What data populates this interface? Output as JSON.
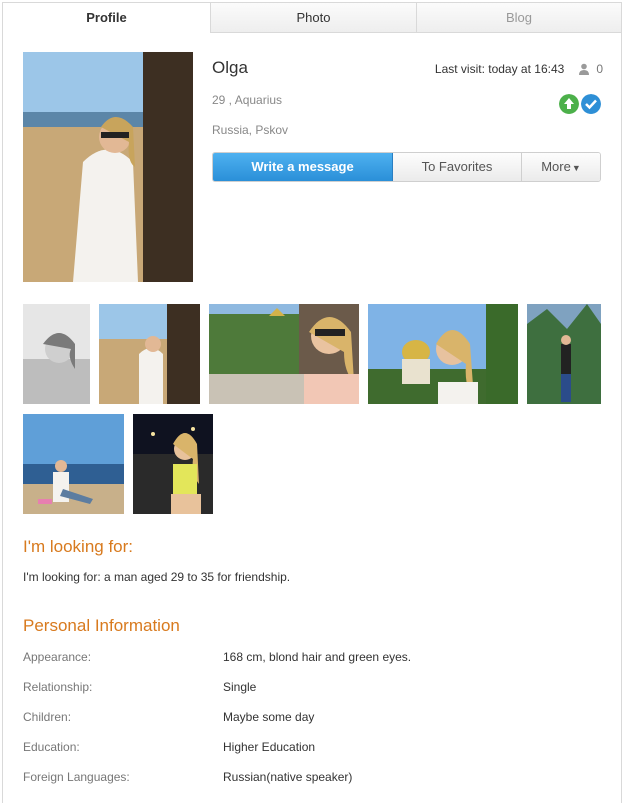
{
  "tabs": [
    {
      "label": "Profile",
      "active": true
    },
    {
      "label": "Photo",
      "active": false
    },
    {
      "label": "Blog",
      "active": false
    }
  ],
  "profile": {
    "name": "Olga",
    "last_visit": "Last visit: today at 16:43",
    "view_count": "0",
    "age_sign": "29 , Aquarius",
    "location": "Russia, Pskov",
    "badges": [
      {
        "icon": "arrow-up-icon",
        "color": "#4cb04a"
      },
      {
        "icon": "check-icon",
        "color": "#2e8fd6"
      }
    ]
  },
  "actions": {
    "message": "Write a message",
    "favorites": "To Favorites",
    "more": "More"
  },
  "looking_for": {
    "title": "I'm looking for:",
    "text": "I'm looking for: a man aged 29 to 35 for friendship."
  },
  "personal": {
    "title": "Personal Information",
    "rows": [
      {
        "label": "Appearance:",
        "value": "168 cm, blond hair and green eyes."
      },
      {
        "label": "Relationship:",
        "value": "Single"
      },
      {
        "label": "Children:",
        "value": "Maybe some day"
      },
      {
        "label": "Education:",
        "value": "Higher Education"
      },
      {
        "label": "Foreign Languages:",
        "value": "Russian(native speaker)"
      }
    ]
  },
  "colors": {
    "accent_orange": "#d87a1e",
    "primary_blue": "#2e8fd6"
  }
}
